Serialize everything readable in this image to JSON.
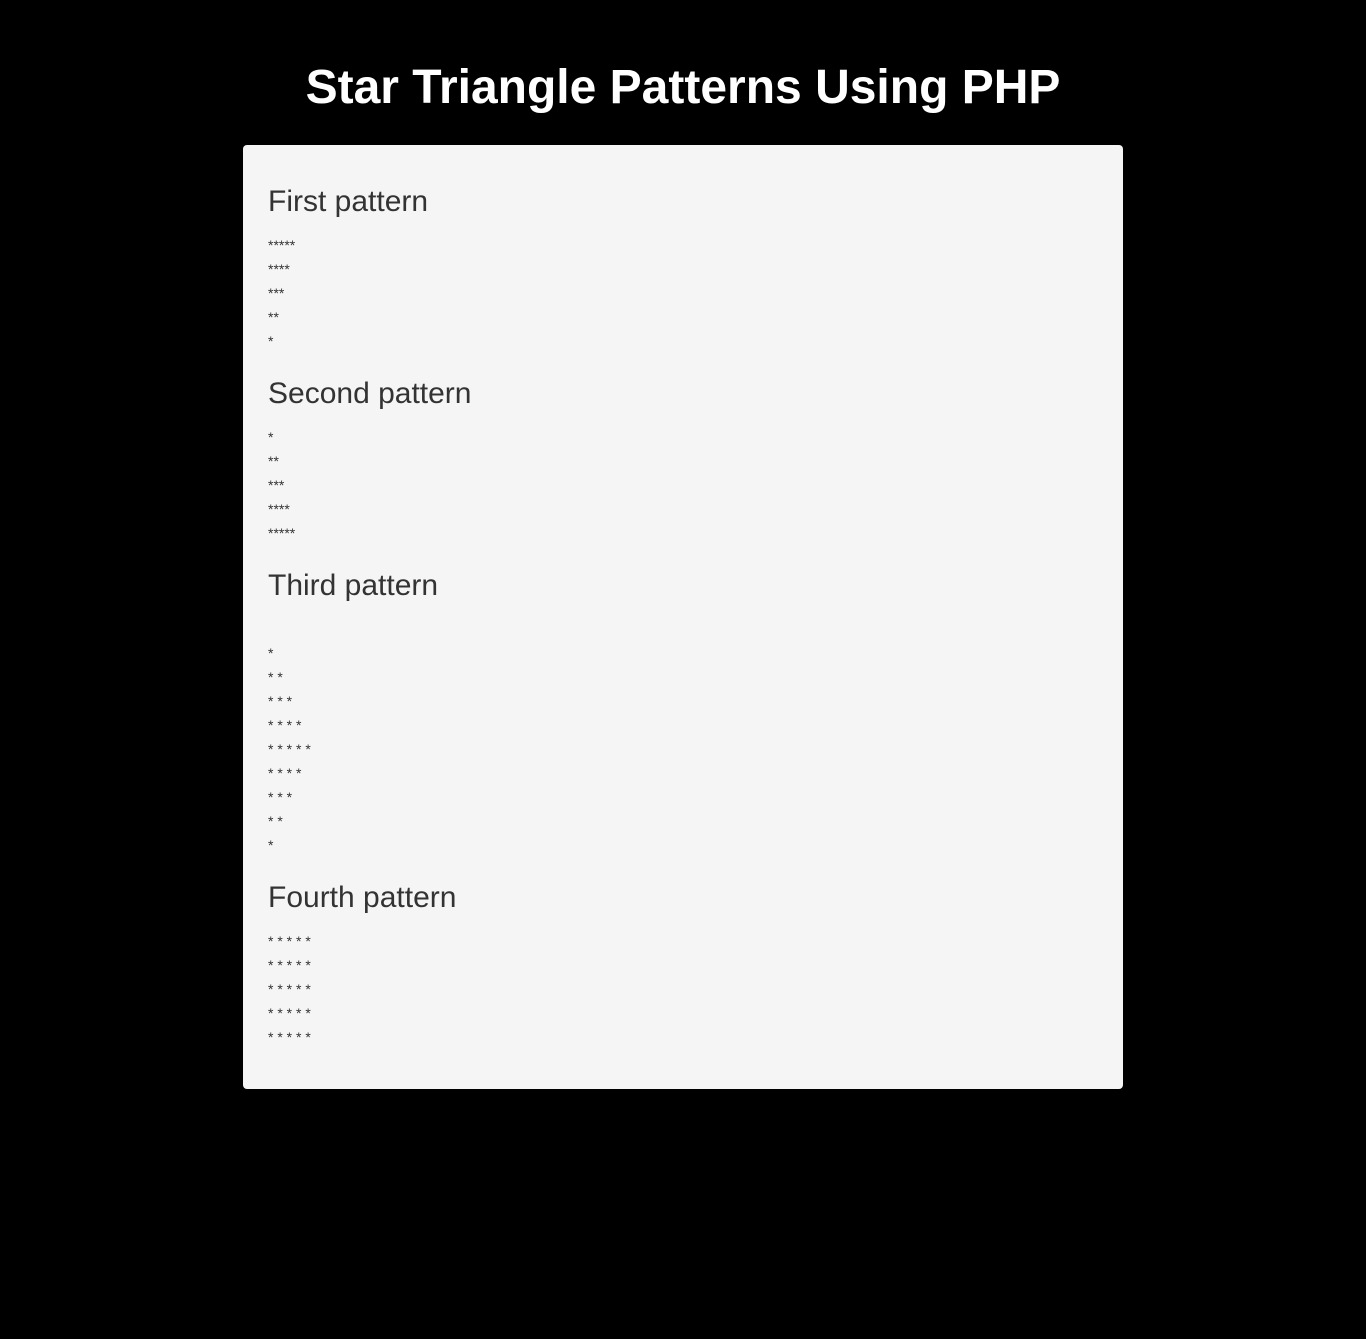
{
  "page_title": "Star Triangle Patterns Using PHP",
  "sections": {
    "first": {
      "heading": "First pattern",
      "lines": [
        "*****",
        "****",
        "***",
        "**",
        "*"
      ]
    },
    "second": {
      "heading": "Second pattern",
      "lines": [
        "*",
        "**",
        "***",
        "****",
        "*****"
      ]
    },
    "third": {
      "heading": "Third pattern",
      "lines": [
        "",
        "*",
        "* *",
        "* * *",
        "* * * *",
        "* * * * *",
        "* * * *",
        "* * *",
        "* *",
        "*"
      ]
    },
    "fourth": {
      "heading": "Fourth pattern",
      "lines": [
        "* * * * *",
        "* * * * *",
        "* * * * *",
        "* * * * *",
        "* * * * *"
      ]
    }
  }
}
